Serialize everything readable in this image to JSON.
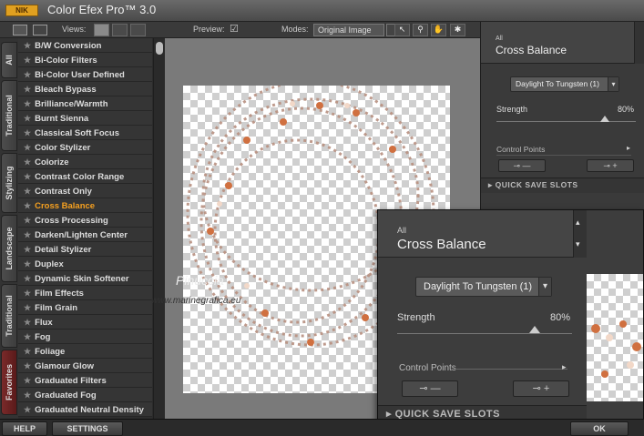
{
  "app": {
    "logo": "NIK",
    "title": "Color Efex Pro™ 3.0"
  },
  "toolbar": {
    "views_label": "Views:",
    "preview_label": "Preview:",
    "preview_check": "☑",
    "modes_label": "Modes:",
    "mode_value": "Original Image"
  },
  "tabs": [
    "All",
    "Traditional",
    "Stylizing",
    "Landscape",
    "Traditional",
    "Favorites"
  ],
  "filters": [
    "B/W Conversion",
    "Bi-Color Filters",
    "Bi-Color User Defined",
    "Bleach Bypass",
    "Brilliance/Warmth",
    "Burnt Sienna",
    "Classical Soft Focus",
    "Color Stylizer",
    "Colorize",
    "Contrast Color Range",
    "Contrast Only",
    "Cross Balance",
    "Cross Processing",
    "Darken/Lighten Center",
    "Detail Stylizer",
    "Duplex",
    "Dynamic Skin Softener",
    "Film Effects",
    "Film Grain",
    "Flux",
    "Fog",
    "Foliage",
    "Glamour Glow",
    "Graduated Filters",
    "Graduated Fog",
    "Graduated Neutral Density"
  ],
  "active_filter_index": 11,
  "watermark": {
    "line1": "Pinuccia",
    "line2": "www.marinegrafica.eu"
  },
  "panel": {
    "category": "All",
    "title": "Cross Balance",
    "preset": "Daylight To Tungsten (1)",
    "strength_label": "Strength",
    "strength_value": "80%",
    "strength_fraction": 0.8,
    "control_points_label": "Control Points",
    "quick_save_label": "QUICK SAVE SLOTS"
  },
  "bottom": {
    "help": "HELP",
    "settings": "SETTINGS",
    "ok": "OK"
  }
}
